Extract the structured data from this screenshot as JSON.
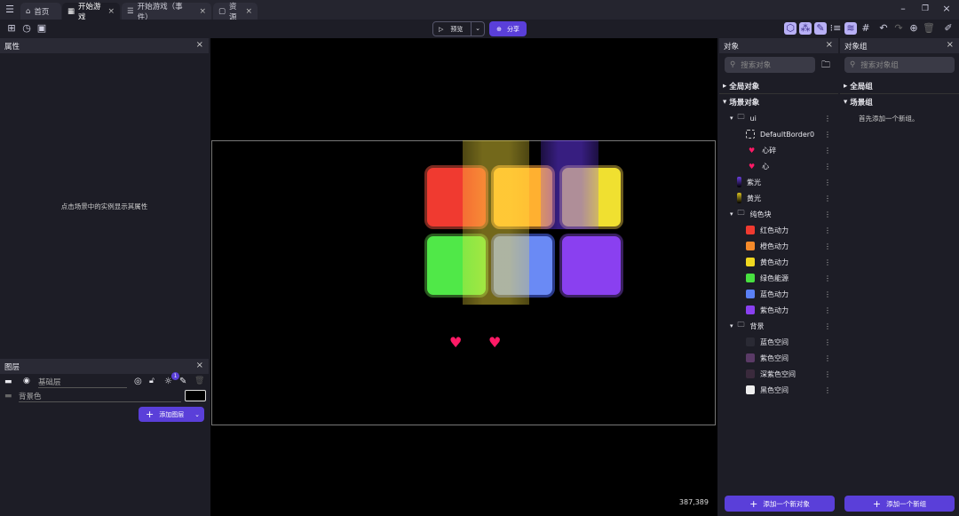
{
  "tabs": [
    {
      "label": "首页",
      "icon": "home-icon"
    },
    {
      "label": "开始游戏",
      "icon": "scene-icon"
    },
    {
      "label": "开始游戏（事件）",
      "icon": "events-icon"
    },
    {
      "label": "资源",
      "icon": "resources-icon"
    }
  ],
  "toolbar": {
    "preview_label": "预览",
    "share_label": "分享"
  },
  "properties": {
    "title": "属性",
    "empty_text": "点击场景中的实例显示其属性"
  },
  "layers": {
    "title": "图层",
    "base_layer": "基础层",
    "background_label": "背景色",
    "badge": "1",
    "add_label": "添加图层",
    "bg_color": "#000000"
  },
  "objects": {
    "title": "对象",
    "search_placeholder": "搜索对象",
    "global_label": "全局对象",
    "scene_label": "场景对象",
    "items": [
      {
        "label": "ui",
        "type": "folder",
        "depth": 1
      },
      {
        "label": "DefaultBorder0",
        "type": "border",
        "depth": 2
      },
      {
        "label": "心碎",
        "type": "heart",
        "depth": 2
      },
      {
        "label": "心",
        "type": "heart",
        "depth": 2
      },
      {
        "label": "紫光",
        "type": "light",
        "color": "#6a3fe0",
        "depth": 1
      },
      {
        "label": "黄光",
        "type": "light",
        "color": "#d8c020",
        "depth": 1
      },
      {
        "label": "纯色块",
        "type": "folder",
        "depth": 1
      },
      {
        "label": "红色动力",
        "type": "swatch",
        "color": "#f03a30",
        "depth": 2
      },
      {
        "label": "橙色动力",
        "type": "swatch",
        "color": "#f58a2a",
        "depth": 2
      },
      {
        "label": "黄色动力",
        "type": "swatch",
        "color": "#f0d820",
        "depth": 2
      },
      {
        "label": "绿色能源",
        "type": "swatch",
        "color": "#48e040",
        "depth": 2
      },
      {
        "label": "蓝色动力",
        "type": "swatch",
        "color": "#5a80f5",
        "depth": 2
      },
      {
        "label": "紫色动力",
        "type": "swatch",
        "color": "#8a40f0",
        "depth": 2
      },
      {
        "label": "背景",
        "type": "folder",
        "depth": 1
      },
      {
        "label": "蓝色空间",
        "type": "swatch",
        "color": "#2a2a34",
        "depth": 2
      },
      {
        "label": "紫色空间",
        "type": "swatch",
        "color": "#5a3a66",
        "depth": 2
      },
      {
        "label": "深紫色空间",
        "type": "swatch",
        "color": "#3a2a3c",
        "depth": 2
      },
      {
        "label": "黑色空间",
        "type": "swatch",
        "color": "#eeeeee",
        "depth": 2
      }
    ],
    "add_label": "添加一个新对象"
  },
  "groups": {
    "title": "对象组",
    "search_placeholder": "搜索对象组",
    "global_label": "全局组",
    "scene_label": "场景组",
    "empty_text": "首先添加一个新组。",
    "add_label": "添加一个新组"
  },
  "canvas": {
    "coords": "387,389"
  },
  "colors": {
    "accent": "#5a3fd9"
  }
}
